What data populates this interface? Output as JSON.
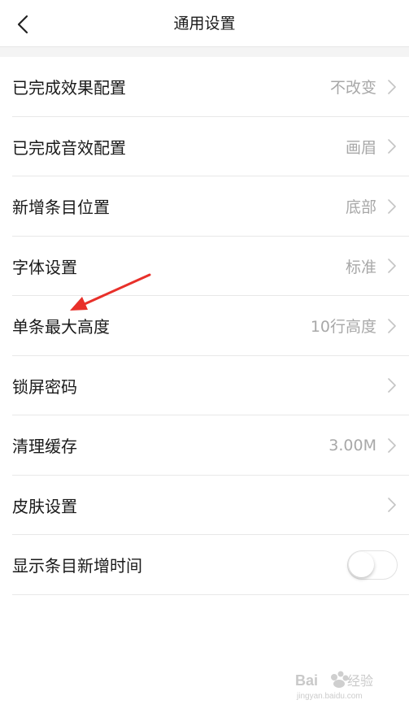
{
  "header": {
    "title": "通用设置",
    "back_icon": "chevron-left-icon"
  },
  "settings": {
    "items": [
      {
        "label": "已完成效果配置",
        "value": "不改变"
      },
      {
        "label": "已完成音效配置",
        "value": "画眉"
      },
      {
        "label": "新增条目位置",
        "value": "底部"
      },
      {
        "label": "字体设置",
        "value": "标准"
      },
      {
        "label": "单条最大高度",
        "value": "10行高度"
      },
      {
        "label": "锁屏密码",
        "value": ""
      },
      {
        "label": "清理缓存",
        "value": "3.00M"
      },
      {
        "label": "皮肤设置",
        "value": ""
      },
      {
        "label": "显示条目新增时间",
        "toggle_on": false
      }
    ]
  },
  "annotation": {
    "color": "#e8302a"
  },
  "watermark": {
    "text": "Baidu 经验",
    "url": "jingyan.baidu.com"
  }
}
